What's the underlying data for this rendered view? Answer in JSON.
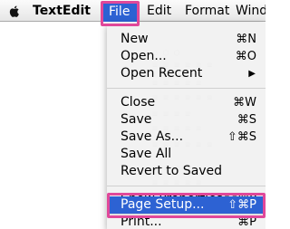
{
  "menubar": {
    "apple_icon": "apple-icon",
    "app_name": "TextEdit",
    "file": "File",
    "edit": "Edit",
    "format": "Format",
    "window": "Wind"
  },
  "file_menu": {
    "new": {
      "label": "New",
      "shortcut": "⌘N"
    },
    "open": {
      "label": "Open...",
      "shortcut": "⌘O"
    },
    "open_recent": {
      "label": "Open Recent",
      "arrow": "▶"
    },
    "close": {
      "label": "Close",
      "shortcut": "⌘W"
    },
    "save": {
      "label": "Save",
      "shortcut": "⌘S"
    },
    "save_as": {
      "label": "Save As...",
      "shortcut": "⇧⌘S"
    },
    "save_all": {
      "label": "Save All"
    },
    "revert": {
      "label": "Revert to Saved"
    },
    "show_properties": {
      "label": "Show Properties",
      "shortcut": "⌥⌘P"
    },
    "page_setup": {
      "label": "Page Setup...",
      "shortcut": "⇧⌘P"
    },
    "print": {
      "label": "Print...",
      "shortcut": "⌘P"
    }
  },
  "accent_color": "#2d62d3",
  "callout_color": "#e0489a"
}
